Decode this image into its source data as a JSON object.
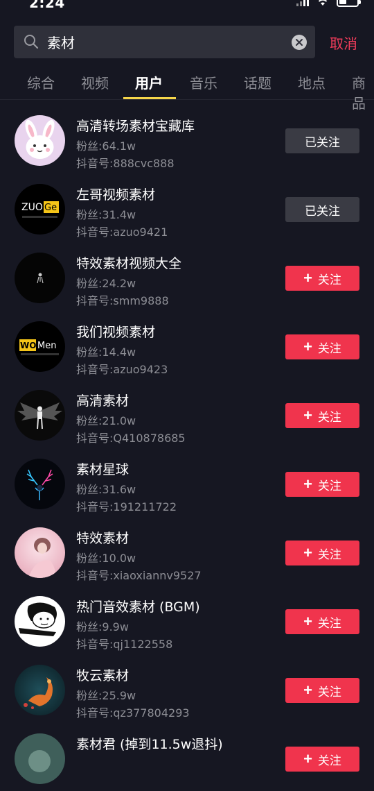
{
  "status": {
    "time": "2:24"
  },
  "search": {
    "query": "素材",
    "cancel_label": "取消"
  },
  "tabs": [
    {
      "label": "综合"
    },
    {
      "label": "视频"
    },
    {
      "label": "用户"
    },
    {
      "label": "音乐"
    },
    {
      "label": "话题"
    },
    {
      "label": "地点"
    },
    {
      "label": "商品"
    }
  ],
  "active_tab": "用户",
  "users": [
    {
      "name": "高清转场素材宝藏库",
      "fans": "粉丝:64.1w",
      "id": "抖音号:888cvc888",
      "button": "已关注",
      "followed": true,
      "avatar": "pink-bunny-avatar"
    },
    {
      "name": "左哥视频素材",
      "fans": "粉丝:31.4w",
      "id": "抖音号:azuo9421",
      "button": "已关注",
      "followed": true,
      "avatar": "zuoge-logo-avatar",
      "avatar_text": "ZUOGe",
      "avatar_sub": "专注后期剪辑素材"
    },
    {
      "name": "特效素材视频大全",
      "fans": "粉丝:24.2w",
      "id": "抖音号:smm9888",
      "button": "关注",
      "followed": false,
      "avatar": "dark-figure-avatar"
    },
    {
      "name": "我们视频素材",
      "fans": "粉丝:14.4w",
      "id": "抖音号:azuo9423",
      "button": "关注",
      "followed": false,
      "avatar": "women-logo-avatar",
      "avatar_text_a": "WO",
      "avatar_text_b": "Men",
      "avatar_sub": "专注后期剪辑素材"
    },
    {
      "name": "高清素材",
      "fans": "粉丝:21.0w",
      "id": "抖音号:Q410878685",
      "button": "关注",
      "followed": false,
      "avatar": "winged-figure-avatar"
    },
    {
      "name": "素材星球",
      "fans": "粉丝:31.6w",
      "id": "抖音号:191211722",
      "button": "关注",
      "followed": false,
      "avatar": "neon-deer-avatar"
    },
    {
      "name": "特效素材",
      "fans": "粉丝:10.0w",
      "id": "抖音号:xiaoxiannv9527",
      "button": "关注",
      "followed": false,
      "avatar": "pink-girl-avatar"
    },
    {
      "name": "热门音效素材 (BGM)",
      "fans": "粉丝:9.9w",
      "id": "抖音号:qj1122558",
      "button": "关注",
      "followed": false,
      "avatar": "cartoon-face-avatar"
    },
    {
      "name": "牧云素材",
      "fans": "粉丝:25.9w",
      "id": "抖音号:qz377804293",
      "button": "关注",
      "followed": false,
      "avatar": "goldfish-avatar"
    },
    {
      "name": "素材君 (掉到11.5w退抖)",
      "fans": "",
      "id": "",
      "button": "关注",
      "followed": false,
      "avatar": "partial-avatar"
    }
  ]
}
